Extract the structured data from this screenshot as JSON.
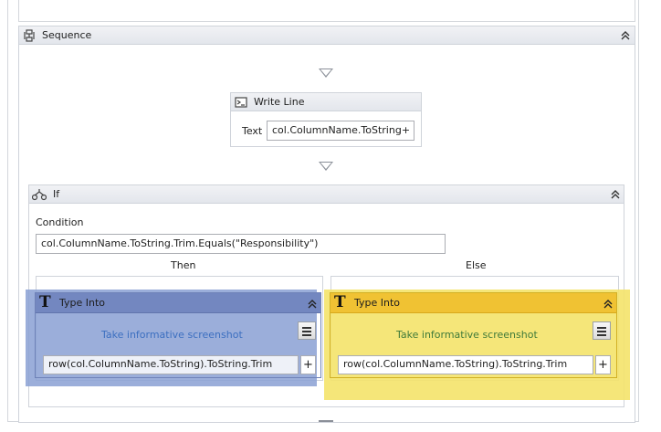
{
  "sequence": {
    "title": "Sequence"
  },
  "write_line": {
    "title": "Write Line",
    "text_label": "Text",
    "text_value": "col.ColumnName.ToString+"
  },
  "if_activity": {
    "title": "If",
    "condition_label": "Condition",
    "condition_value": "col.ColumnName.ToString.Trim.Equals(\"Responsibility\")",
    "then_label": "Then",
    "else_label": "Else"
  },
  "then_type_into": {
    "title": "Type Into",
    "screenshot_link": "Take informative screenshot",
    "value": "row(col.ColumnName.ToString).ToString.Trim",
    "plus": "+"
  },
  "else_type_into": {
    "title": "Type Into",
    "screenshot_link": "Take informative screenshot",
    "value": "row(col.ColumnName.ToString).ToString.Trim",
    "plus": "+"
  },
  "icons": {
    "sequence": "sequence-icon",
    "write_line": "write-line-icon",
    "if": "if-icon",
    "type_into": "type-into-t-icon",
    "collapse": "double-chevron-up-icon",
    "menu": "hamburger-menu-icon"
  },
  "colors": {
    "then_highlight": "#7e92c7",
    "else_highlight": "#f1d84a",
    "else_header": "#f1c232",
    "link_blue": "#3c6fc0",
    "link_green": "#3f7a3a"
  }
}
